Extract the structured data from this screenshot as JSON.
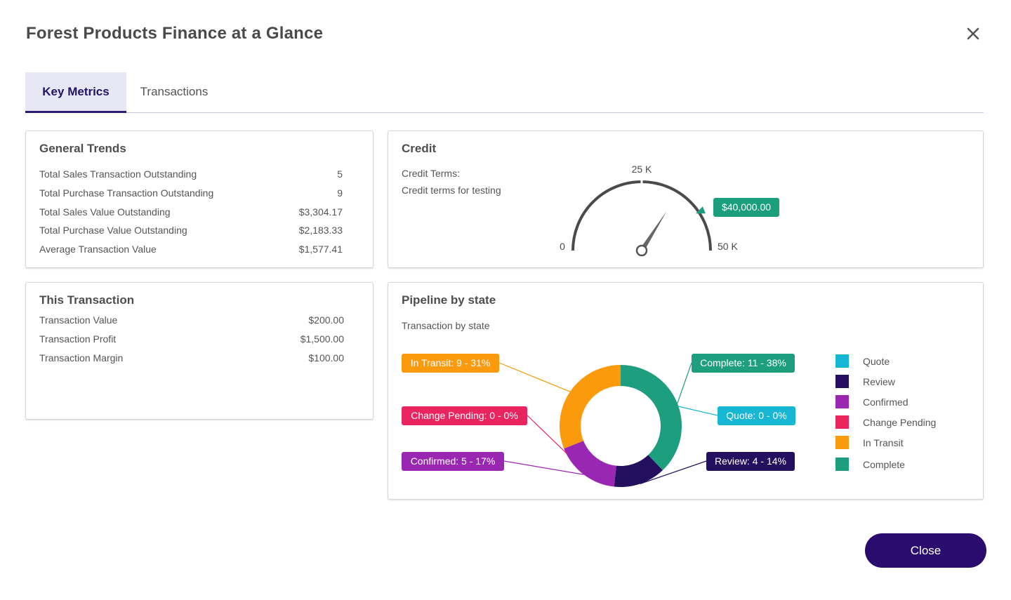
{
  "dialog": {
    "title": "Forest Products Finance at a Glance",
    "close_button": "Close"
  },
  "tabs": [
    {
      "label": "Key Metrics",
      "active": true
    },
    {
      "label": "Transactions",
      "active": false
    }
  ],
  "general_trends": {
    "title": "General Trends",
    "rows": [
      {
        "label": "Total Sales Transaction Outstanding",
        "value": "5"
      },
      {
        "label": "Total Purchase Transaction Outstanding",
        "value": "9"
      },
      {
        "label": "Total Sales Value Outstanding",
        "value": "$3,304.17"
      },
      {
        "label": "Total Purchase Value Outstanding",
        "value": "$2,183.33"
      },
      {
        "label": "Average Transaction Value",
        "value": "$1,577.41"
      }
    ]
  },
  "this_transaction": {
    "title": "This Transaction",
    "rows": [
      {
        "label": "Transaction Value",
        "value": "$200.00"
      },
      {
        "label": "Transaction Profit",
        "value": "$1,500.00"
      },
      {
        "label": "Transaction Margin",
        "value": "$100.00"
      }
    ]
  },
  "credit": {
    "title": "Credit",
    "terms_label": "Credit Terms:",
    "terms_value": "Credit terms for testing",
    "gauge": {
      "min_label": "0",
      "mid_label": "25 K",
      "max_label": "50 K",
      "value_label": "$40,000.00",
      "min": 0,
      "max": 50000,
      "limit": 40000,
      "needle_value": 34000,
      "tag_color": "#1a9e7b"
    }
  },
  "pipeline": {
    "title": "Pipeline by state",
    "subtitle": "Transaction by state",
    "legend": [
      {
        "label": "Quote",
        "color": "#17b6d3"
      },
      {
        "label": "Review",
        "color": "#25105f"
      },
      {
        "label": "Confirmed",
        "color": "#9a27b2"
      },
      {
        "label": "Change Pending",
        "color": "#e9245e"
      },
      {
        "label": "In Transit",
        "color": "#fb9a0c"
      },
      {
        "label": "Complete",
        "color": "#1d9e7e"
      }
    ]
  },
  "chart_data": {
    "type": "pie",
    "title": "Transaction by state",
    "slices": [
      {
        "label": "Complete",
        "value": 11,
        "percent": 38,
        "color": "#1d9e7e",
        "callout": "Complete: 11 - 38%"
      },
      {
        "label": "Quote",
        "value": 0,
        "percent": 0,
        "color": "#17b6d3",
        "callout": "Quote: 0 - 0%"
      },
      {
        "label": "Review",
        "value": 4,
        "percent": 14,
        "color": "#25105f",
        "callout": "Review: 4 - 14%"
      },
      {
        "label": "Confirmed",
        "value": 5,
        "percent": 17,
        "color": "#9a27b2",
        "callout": "Confirmed: 5 - 17%"
      },
      {
        "label": "Change Pending",
        "value": 0,
        "percent": 0,
        "color": "#e9245e",
        "callout": "Change Pending: 0 - 0%"
      },
      {
        "label": "In Transit",
        "value": 9,
        "percent": 31,
        "color": "#fb9a0c",
        "callout": "In Transit: 9 - 31%"
      }
    ],
    "donut": true,
    "legend_position": "right"
  }
}
